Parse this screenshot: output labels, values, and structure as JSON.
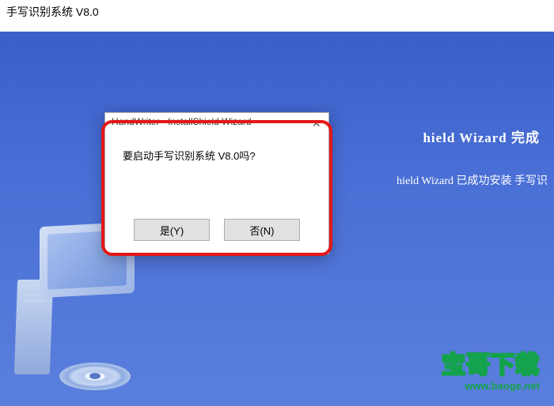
{
  "window": {
    "title": "手写识别系统 V8.0"
  },
  "wizard": {
    "complete_suffix": "hield Wizard 完成",
    "installed_suffix": "hield Wizard 已成功安装 手写识"
  },
  "dialog": {
    "title": "HandWriter - InstallShield Wizard",
    "message": "要启动手写识别系统 V8.0吗?",
    "yes_label": "是(Y)",
    "no_label": "否(N)"
  },
  "watermark": {
    "brand": "宝哥下载",
    "url": "www.baoge.net"
  }
}
